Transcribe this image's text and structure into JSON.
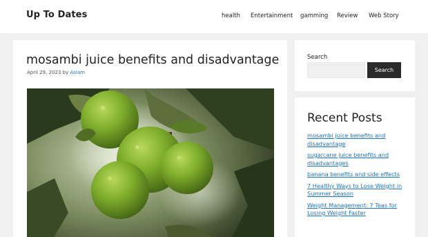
{
  "site": {
    "title": "Up To Dates"
  },
  "nav": {
    "items": [
      {
        "label": "health"
      },
      {
        "label": "Entertainment"
      },
      {
        "label": "gamming"
      },
      {
        "label": "Review"
      },
      {
        "label": "Web Story"
      }
    ]
  },
  "post": {
    "title": "mosambi juice benefits and disadvantage",
    "date": "April 29, 2023",
    "by": "by",
    "author": "Aslam"
  },
  "search": {
    "title": "Search",
    "placeholder": "",
    "button_label": "Search"
  },
  "recent": {
    "title": "Recent Posts",
    "items": [
      {
        "label": "mosambi juice benefits and disadvantage"
      },
      {
        "label": "sugarcane juice benefits and disadvantages"
      },
      {
        "label": "banana benefits and side effects"
      },
      {
        "label": "7 Healthy Ways to Lose Weight in Summer Season"
      },
      {
        "label": "Weight Management: 7 Teas for Losing Weight Faster"
      }
    ]
  }
}
